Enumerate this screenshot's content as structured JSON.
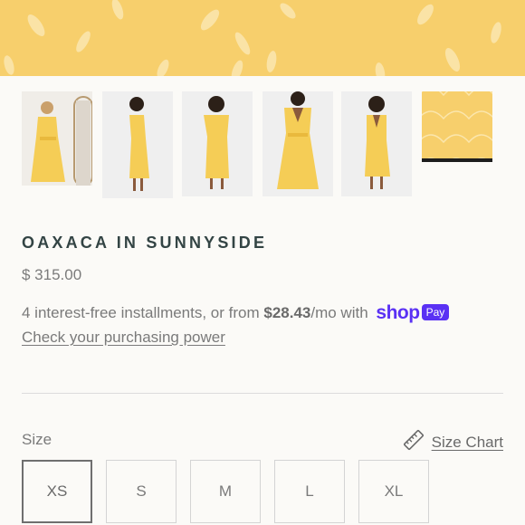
{
  "product": {
    "title": "OAXACA IN SUNNYSIDE",
    "price": "$ 315.00"
  },
  "installments": {
    "prefix": "4 interest-free installments, or from ",
    "amount": "$28.43",
    "suffix": "/mo with",
    "brand": "shop",
    "badge": "Pay",
    "check_link": "Check your purchasing power"
  },
  "gallery": {
    "thumbnails": [
      {
        "alt": "model-mirror"
      },
      {
        "alt": "model-side"
      },
      {
        "alt": "model-back"
      },
      {
        "alt": "model-front"
      },
      {
        "alt": "model-front-2"
      },
      {
        "alt": "fabric-swatch"
      }
    ],
    "active_index": 5
  },
  "size": {
    "label": "Size",
    "chart_label": "Size Chart",
    "chart_icon": "ruler-icon",
    "options": [
      "XS",
      "S",
      "M",
      "L",
      "XL"
    ],
    "selected": "XS"
  },
  "colors": {
    "dress": "#f5cd56",
    "hero_bg": "#f7cf6c",
    "shop_brand": "#5a31f4"
  }
}
